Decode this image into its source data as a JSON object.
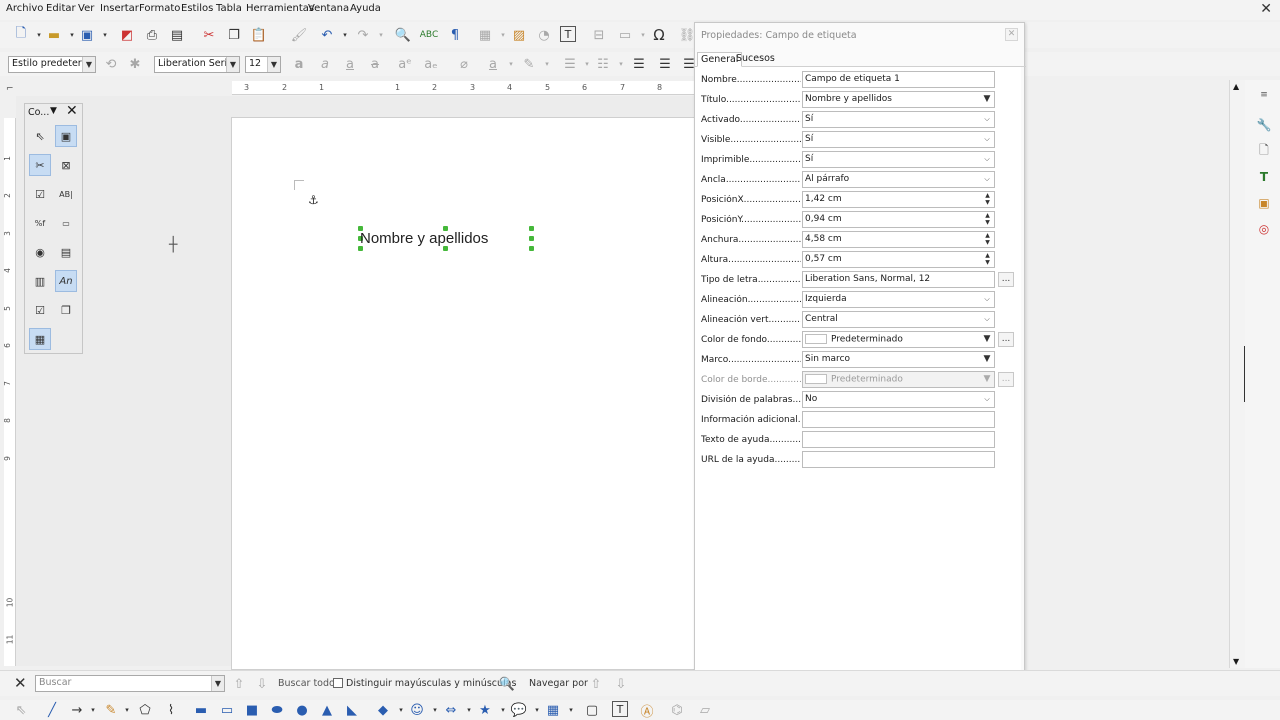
{
  "menu": {
    "items": [
      "Archivo",
      "Editar",
      "Ver",
      "Insertar",
      "Formato",
      "Estilos",
      "Tabla",
      "Herramientas",
      "Ventana",
      "Ayuda"
    ]
  },
  "formatting": {
    "paragraph_style": "Estilo predeterm",
    "font_name": "Liberation Serif",
    "font_size": "12"
  },
  "ruler": {
    "horizontal_ticks": [
      "3",
      "2",
      "1",
      "1",
      "2",
      "3",
      "4",
      "5",
      "6",
      "7",
      "8"
    ],
    "vertical_ticks": [
      "1",
      "2",
      "3",
      "4",
      "5",
      "6",
      "7",
      "8",
      "9",
      "10",
      "11"
    ]
  },
  "controls_panel": {
    "title": "Co..."
  },
  "document": {
    "label_field_text": "Nombre y apellidos"
  },
  "dialog": {
    "title": "Propiedades: Campo de etiqueta",
    "tabs": [
      "General",
      "Sucesos"
    ],
    "properties": [
      {
        "label": "Nombre.......................",
        "value": "Campo de etiqueta 1",
        "kind": "text"
      },
      {
        "label": "Título.............................",
        "value": "Nombre y apellidos",
        "kind": "combo"
      },
      {
        "label": "Activado...........................",
        "value": "Sí",
        "kind": "select"
      },
      {
        "label": "Visible..............................",
        "value": "Sí",
        "kind": "select"
      },
      {
        "label": "Imprimible.......................",
        "value": "Sí",
        "kind": "select"
      },
      {
        "label": "Ancla..................................",
        "value": "Al párrafo",
        "kind": "select"
      },
      {
        "label": "PosiciónX.........................",
        "value": "1,42 cm",
        "kind": "spin"
      },
      {
        "label": "PosiciónY.........................",
        "value": "0,94 cm",
        "kind": "spin"
      },
      {
        "label": "Anchura..........................",
        "value": "4,58 cm",
        "kind": "spin"
      },
      {
        "label": "Altura...............................",
        "value": "0,57 cm",
        "kind": "spin"
      },
      {
        "label": "Tipo de letra..................",
        "value": "Liberation Sans, Normal, 12",
        "kind": "text-more"
      },
      {
        "label": "Alineación........................",
        "value": "Izquierda",
        "kind": "select"
      },
      {
        "label": "Alineación vert..............",
        "value": "Central",
        "kind": "select"
      },
      {
        "label": "Color de fondo.................",
        "value": "Predeterminado",
        "kind": "color-more"
      },
      {
        "label": "Marco................................",
        "value": "Sin marco",
        "kind": "select"
      },
      {
        "label": "Color de borde..................",
        "value": "Predeterminado",
        "kind": "color-more-disabled"
      },
      {
        "label": "División de palabras........",
        "value": "No",
        "kind": "select"
      },
      {
        "label": "Información adicional.....",
        "value": "",
        "kind": "text"
      },
      {
        "label": "Texto de ayuda...................",
        "value": "",
        "kind": "text"
      },
      {
        "label": "URL de la ayuda..................",
        "value": "",
        "kind": "text"
      }
    ]
  },
  "findbar": {
    "search_placeholder": "Buscar",
    "find_all": "Buscar todo",
    "match_case": "Distinguir mayúsculas y minúsculas",
    "navigate_by": "Navegar por"
  },
  "colors": {
    "selection_handle": "#45b83a",
    "active_control_bg": "#c7dcf3"
  }
}
